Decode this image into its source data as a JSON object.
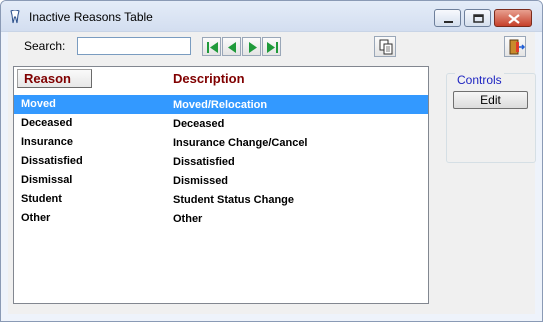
{
  "window": {
    "title": "Inactive Reasons Table"
  },
  "search": {
    "label": "Search:",
    "value": "",
    "placeholder": ""
  },
  "table": {
    "columns": [
      "Reason",
      "Description"
    ],
    "selected_index": 0,
    "rows": [
      {
        "reason": "Moved",
        "description": "Moved/Relocation"
      },
      {
        "reason": "Deceased",
        "description": "Deceased"
      },
      {
        "reason": "Insurance",
        "description": "Insurance Change/Cancel"
      },
      {
        "reason": "Dissatisfied",
        "description": "Dissatisfied"
      },
      {
        "reason": "Dismissal",
        "description": "Dismissed"
      },
      {
        "reason": "Student",
        "description": "Student Status Change"
      },
      {
        "reason": "Other",
        "description": "Other"
      }
    ]
  },
  "controls": {
    "label": "Controls",
    "edit_label": "Edit"
  },
  "colors": {
    "selection": "#3399ff",
    "header_text": "#800000",
    "nav_green": "#1f9a3a",
    "controls_label": "#1f25c2"
  },
  "icons": [
    "app-tooth-icon",
    "minimize-icon",
    "maximize-icon",
    "close-icon",
    "first-record-icon",
    "previous-record-icon",
    "next-record-icon",
    "last-record-icon",
    "copy-icon",
    "exit-door-icon"
  ]
}
